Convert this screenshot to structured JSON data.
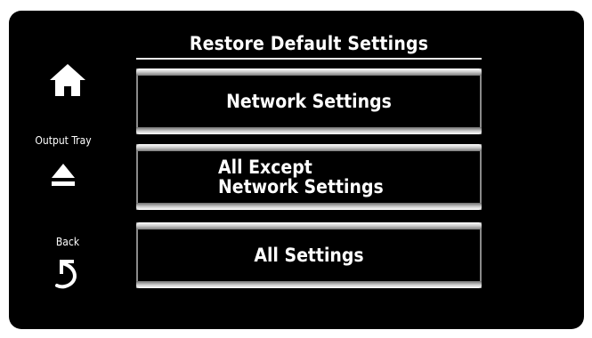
{
  "screen": {
    "title": "Restore Default Settings"
  },
  "sidebar": {
    "home": {
      "icon": "home-icon"
    },
    "output_tray": {
      "label": "Output Tray",
      "icon": "eject-icon"
    },
    "back": {
      "label": "Back",
      "icon": "back-arrow-icon"
    }
  },
  "menu": {
    "items": [
      {
        "label": "Network Settings"
      },
      {
        "label_line1": "All Except",
        "label_line2": "Network Settings"
      },
      {
        "label": "All Settings"
      }
    ]
  },
  "colors": {
    "background": "#000000",
    "text": "#ffffff",
    "button_bevel": "#cfcfcf"
  }
}
